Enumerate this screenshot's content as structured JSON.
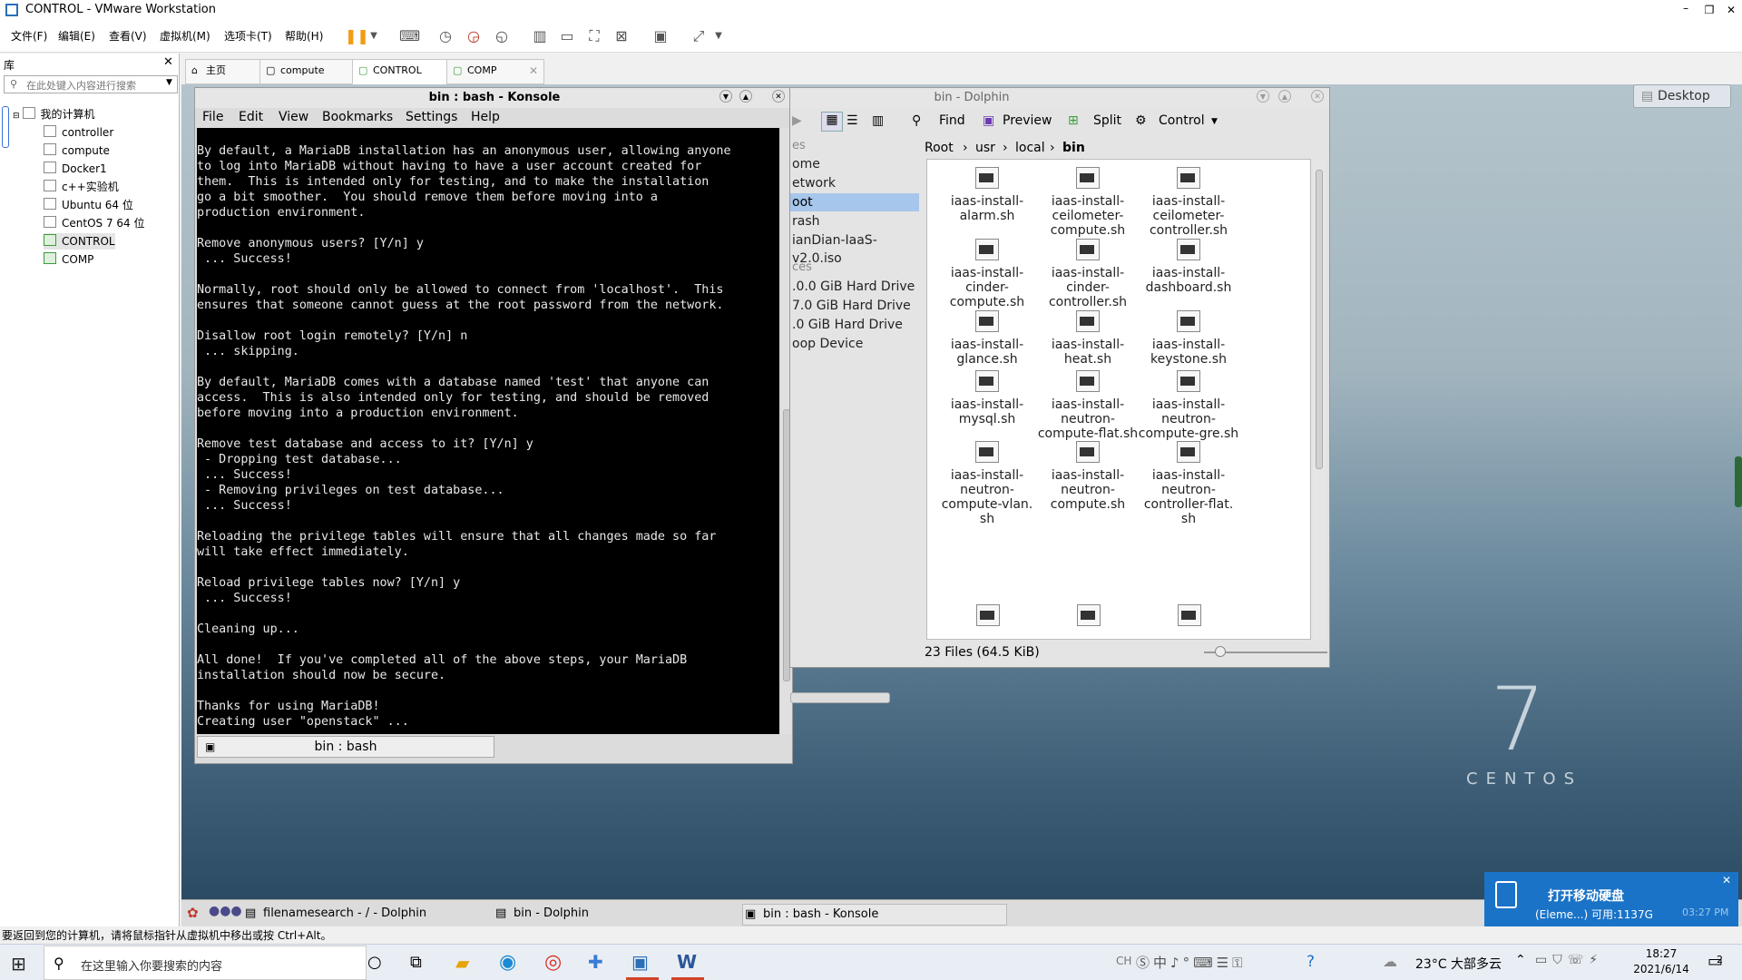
{
  "vmware": {
    "title": "CONTROL - VMware Workstation",
    "menu": [
      "文件(F)",
      "编辑(E)",
      "查看(V)",
      "虚拟机(M)",
      "选项卡(T)",
      "帮助(H)"
    ],
    "library": {
      "title": "库",
      "search_placeholder": "在此处键入内容进行搜索",
      "root": "我的计算机",
      "items": [
        "controller",
        "compute",
        "Docker1",
        "c++实验机",
        "Ubuntu 64 位",
        "CentOS 7 64 位",
        "CONTROL",
        "COMP"
      ]
    },
    "tabs": [
      "主页",
      "compute",
      "CONTROL",
      "COMP"
    ],
    "status_text": "要返回到您的计算机，请将鼠标指针从虚拟机中移出或按 Ctrl+Alt。"
  },
  "konsole": {
    "title": "bin : bash - Konsole",
    "menu": [
      "File",
      "Edit",
      "View",
      "Bookmarks",
      "Settings",
      "Help"
    ],
    "tab_label": "bin : bash",
    "lines": [
      "By default, a MariaDB installation has an anonymous user, allowing anyone",
      "to log into MariaDB without having to have a user account created for",
      "them.  This is intended only for testing, and to make the installation",
      "go a bit smoother.  You should remove them before moving into a",
      "production environment.",
      "",
      "Remove anonymous users? [Y/n] y",
      " ... Success!",
      "",
      "Normally, root should only be allowed to connect from 'localhost'.  This",
      "ensures that someone cannot guess at the root password from the network.",
      "",
      "Disallow root login remotely? [Y/n] n",
      " ... skipping.",
      "",
      "By default, MariaDB comes with a database named 'test' that anyone can",
      "access.  This is also intended only for testing, and should be removed",
      "before moving into a production environment.",
      "",
      "Remove test database and access to it? [Y/n] y",
      " - Dropping test database...",
      " ... Success!",
      " - Removing privileges on test database...",
      " ... Success!",
      "",
      "Reloading the privilege tables will ensure that all changes made so far",
      "will take effect immediately.",
      "",
      "Reload privilege tables now? [Y/n] y",
      " ... Success!",
      "",
      "Cleaning up...",
      "",
      "All done!  If you've completed all of the above steps, your MariaDB",
      "installation should now be secure.",
      "",
      "Thanks for using MariaDB!",
      "Creating user \"openstack\" ..."
    ]
  },
  "dolphin": {
    "title": "bin - Dolphin",
    "toolbar": {
      "find": "Find",
      "preview": "Preview",
      "split": "Split",
      "control": "Control"
    },
    "breadcrumb": [
      "Root",
      "usr",
      "local",
      "bin"
    ],
    "places_header": "es",
    "places": [
      "ome",
      "etwork",
      "oot",
      "rash",
      "ianDian-IaaS-v2.0.iso"
    ],
    "devices_header": "ces",
    "devices": [
      ".0.0 GiB Hard Drive",
      "7.0 GiB Hard Drive",
      ".0 GiB Hard Drive",
      "oop Device"
    ],
    "files": [
      [
        "iaas-install-",
        "alarm.sh"
      ],
      [
        "iaas-install-",
        "ceilometer-",
        "compute.sh"
      ],
      [
        "iaas-install-",
        "ceilometer-",
        "controller.sh"
      ],
      [
        "iaas-install-",
        "cinder-",
        "compute.sh"
      ],
      [
        "iaas-install-",
        "cinder-",
        "controller.sh"
      ],
      [
        "iaas-install-",
        "dashboard.sh"
      ],
      [
        "iaas-install-",
        "glance.sh"
      ],
      [
        "iaas-install-",
        "heat.sh"
      ],
      [
        "iaas-install-",
        "keystone.sh"
      ],
      [
        "iaas-install-",
        "mysql.sh"
      ],
      [
        "iaas-install-",
        "neutron-",
        "compute-flat.sh"
      ],
      [
        "iaas-install-",
        "neutron-",
        "compute-gre.sh"
      ],
      [
        "iaas-install-",
        "neutron-",
        "compute-vlan.",
        "sh"
      ],
      [
        "iaas-install-",
        "neutron-",
        "compute.sh"
      ],
      [
        "iaas-install-",
        "neutron-",
        "controller-flat.",
        "sh"
      ]
    ],
    "status": "23 Files (64.5 KiB)"
  },
  "desktop": {
    "desktop_button": "Desktop",
    "centos_number": "7",
    "centos_text": "CENTOS"
  },
  "kde_panel": {
    "tasks": [
      "filenamesearch - / - Dolphin",
      "bin - Dolphin",
      "bin : bash - Konsole"
    ]
  },
  "notification": {
    "title": "打开移动硬盘",
    "detail": "(Eleme...)  可用:1137G",
    "time": "03:27 PM"
  },
  "windows_taskbar": {
    "search_placeholder": "在这里输入你要搜索的内容",
    "weather": "23°C  大部多云",
    "time": "18:27",
    "date": "2021/6/14",
    "notif_count": "2"
  }
}
